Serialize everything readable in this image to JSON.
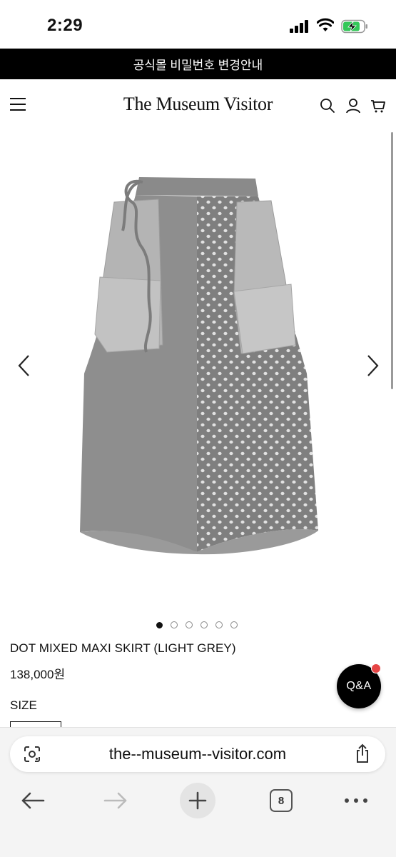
{
  "status": {
    "time": "2:29"
  },
  "notice": {
    "text": "공식몰 비밀번호 변경안내"
  },
  "header": {
    "brand": "The Museum Visitor"
  },
  "carousel": {
    "total": 6,
    "active_index": 0
  },
  "product": {
    "name": "DOT MIXED MAXI SKIRT (LIGHT GREY)",
    "price": "138,000원",
    "size_label": "SIZE"
  },
  "qa": {
    "label": "Q&A"
  },
  "browser": {
    "url": "the--museum--visitor.com",
    "tab_count": "8"
  },
  "colors": {
    "notice_bg": "#000000",
    "qa_badge": "#e64545",
    "battery_green": "#34c759"
  }
}
